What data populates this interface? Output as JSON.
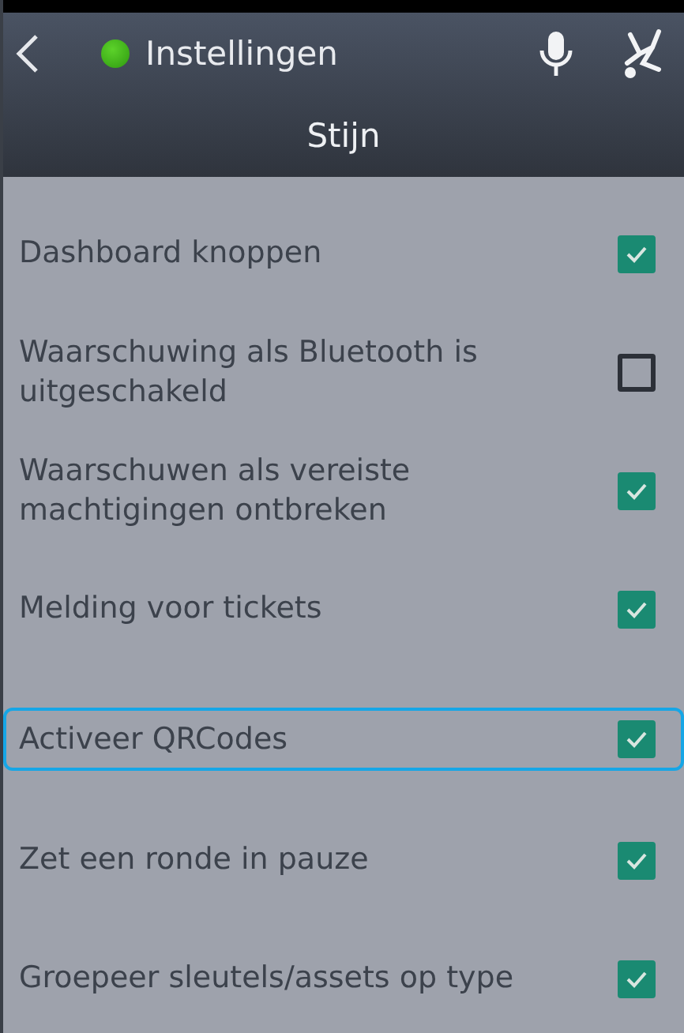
{
  "header": {
    "title": "Instellingen",
    "online": true,
    "subtitle": "Stijn"
  },
  "settings": [
    {
      "label": "Dashboard knoppen",
      "checked": true,
      "focused": false
    },
    {
      "label": "Waarschuwing als Bluetooth is uitgeschakeld",
      "checked": false,
      "focused": false
    },
    {
      "label": "Waarschuwen als vereiste machtigingen ontbreken",
      "checked": true,
      "focused": false
    },
    {
      "label": "Melding voor tickets",
      "checked": true,
      "focused": false
    },
    {
      "label": "Activeer QRCodes",
      "checked": true,
      "focused": true
    },
    {
      "label": "Zet een ronde in pauze",
      "checked": true,
      "focused": false
    },
    {
      "label": "Groepeer sleutels/assets op type",
      "checked": true,
      "focused": false
    }
  ]
}
